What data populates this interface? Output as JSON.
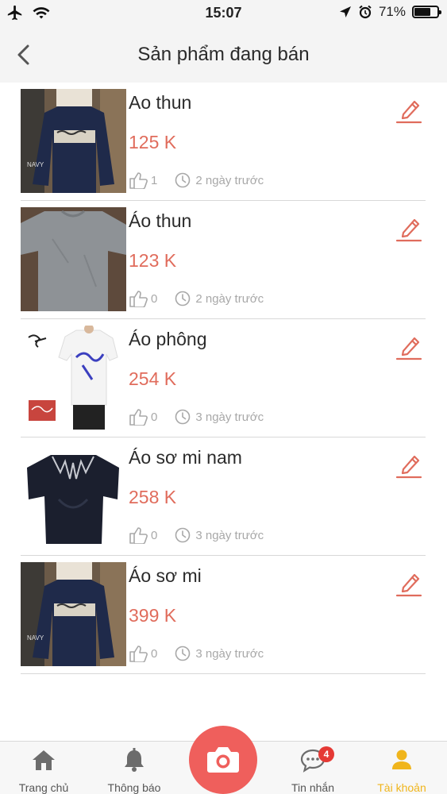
{
  "status_bar": {
    "time": "15:07",
    "battery": "71%",
    "battery_level": 0.71
  },
  "header": {
    "title": "Sản phẩm đang bán",
    "back_icon": "chevron-left-icon"
  },
  "products": [
    {
      "name": "Ao thun",
      "price": "125 K",
      "likes": "1",
      "posted": "2 ngày trước",
      "image": "navy-longsleeve-shirt"
    },
    {
      "name": "Áo thun",
      "price": "123 K",
      "likes": "0",
      "posted": "2 ngày trước",
      "image": "grey-tshirt"
    },
    {
      "name": "Áo phông",
      "price": "254 K",
      "likes": "0",
      "posted": "3 ngày trước",
      "image": "white-stussy-tshirt"
    },
    {
      "name": "Áo sơ mi nam",
      "price": "258 K",
      "likes": "0",
      "posted": "3 ngày trước",
      "image": "black-compression-tshirt"
    },
    {
      "name": "Áo sơ mi",
      "price": "399 K",
      "likes": "0",
      "posted": "3 ngày trước",
      "image": "navy-longsleeve-shirt"
    }
  ],
  "bottom_nav": {
    "home": "Trang chủ",
    "notifications": "Thông báo",
    "messages": "Tin nhắn",
    "messages_badge": "4",
    "account": "Tài khoản"
  },
  "colors": {
    "price": "#e06c5c",
    "accent": "#ef5f5c",
    "active_tab": "#f0b51c",
    "header_bg": "#f4f4f4"
  }
}
